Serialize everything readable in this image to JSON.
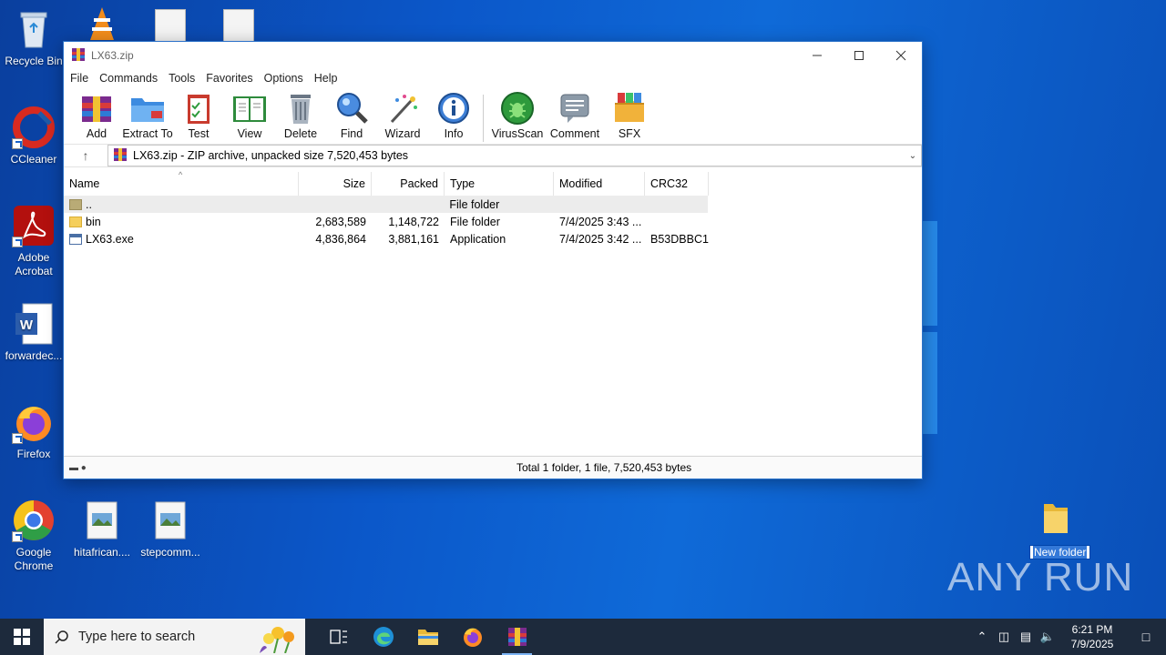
{
  "desktop": {
    "icons": [
      {
        "label": "Recycle Bin"
      },
      {
        "label": "CCleaner"
      },
      {
        "label": "Adobe Acrobat"
      },
      {
        "label": "forwardec..."
      },
      {
        "label": "Firefox"
      },
      {
        "label": "Google Chrome"
      },
      {
        "label": "hitafrican...."
      },
      {
        "label": "stepcomm..."
      }
    ],
    "new_folder_label": "New folder",
    "watermark": "ANY RUN"
  },
  "window": {
    "title": "LX63.zip",
    "menu": [
      "File",
      "Commands",
      "Tools",
      "Favorites",
      "Options",
      "Help"
    ],
    "toolbar": [
      "Add",
      "Extract To",
      "Test",
      "View",
      "Delete",
      "Find",
      "Wizard",
      "Info",
      "VirusScan",
      "Comment",
      "SFX"
    ],
    "address": "LX63.zip - ZIP archive, unpacked size 7,520,453 bytes",
    "columns": [
      "Name",
      "Size",
      "Packed",
      "Type",
      "Modified",
      "CRC32"
    ],
    "rows": [
      {
        "name": "..",
        "size": "",
        "packed": "",
        "type": "File folder",
        "modified": "",
        "crc": ""
      },
      {
        "name": "bin",
        "size": "2,683,589",
        "packed": "1,148,722",
        "type": "File folder",
        "modified": "7/4/2025 3:43 ...",
        "crc": ""
      },
      {
        "name": "LX63.exe",
        "size": "4,836,864",
        "packed": "3,881,161",
        "type": "Application",
        "modified": "7/4/2025 3:42 ...",
        "crc": "B53DBBC1"
      }
    ],
    "status": "Total 1 folder, 1 file, 7,520,453 bytes"
  },
  "taskbar": {
    "search_placeholder": "Type here to search",
    "time": "6:21 PM",
    "date": "7/9/2025"
  },
  "colors": {
    "accent": "#0b57c9",
    "taskbar": "#1d2a3c"
  }
}
